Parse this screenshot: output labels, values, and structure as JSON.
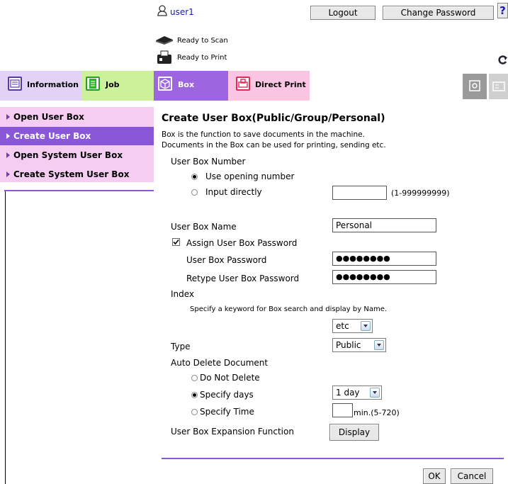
{
  "header": {
    "username": "user1",
    "logout_label": "Logout",
    "change_password_label": "Change Password",
    "help_label": "?",
    "scan_status": "Ready to Scan",
    "print_status": "Ready to Print"
  },
  "tabs": [
    {
      "label": "Information"
    },
    {
      "label": "Job"
    },
    {
      "label": "Box"
    },
    {
      "label": "Direct Print"
    }
  ],
  "sidebar": {
    "items": [
      {
        "label": "Open User Box"
      },
      {
        "label": "Create User Box"
      },
      {
        "label": "Open System User Box"
      },
      {
        "label": "Create System User Box"
      }
    ]
  },
  "main": {
    "title": "Create User Box(Public/Group/Personal)",
    "description1": "Box is the function to save documents in the machine.",
    "description2": "Documents in the Box can be used for printing, sending etc.",
    "box_number_label": "User Box Number",
    "use_opening_number": "Use opening number",
    "input_directly": "Input directly",
    "number_range": "(1-999999999)",
    "box_name_label": "User Box Name",
    "box_name_value": "Personal",
    "assign_password_label": "Assign User Box Password",
    "password_label": "User Box Password",
    "password_value": "●●●●●●●●",
    "retype_password_label": "Retype User Box Password",
    "retype_password_value": "●●●●●●●●",
    "index_label": "Index",
    "index_hint": "Specify a keyword for Box search and display by Name.",
    "index_value": "etc",
    "type_label": "Type",
    "type_value": "Public",
    "auto_delete_label": "Auto Delete Document",
    "do_not_delete": "Do Not Delete",
    "specify_days": "Specify days",
    "days_value": "1 day",
    "specify_time": "Specify Time",
    "time_range": "min.(5-720)",
    "expansion_label": "User Box Expansion Function",
    "display_label": "Display",
    "ok_label": "OK",
    "cancel_label": "Cancel"
  },
  "colors": {
    "sidebar_bg": "#f5ccf2",
    "sidebar_active": "#8a57d8",
    "box_tab": "#9d66e0",
    "info_tab": "#e2d2f6",
    "job_tab": "#cdf09a",
    "print_tab": "#f9c5e3",
    "divider": "#8a57d8"
  }
}
